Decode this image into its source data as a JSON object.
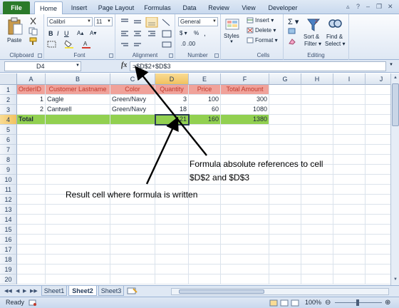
{
  "ribbon_tabs": {
    "file": "File",
    "items": [
      "Home",
      "Insert",
      "Page Layout",
      "Formulas",
      "Data",
      "Review",
      "View",
      "Developer"
    ]
  },
  "clipboard": {
    "paste": "Paste",
    "label": "Clipboard"
  },
  "font": {
    "name": "Calibri",
    "size": "11",
    "label": "Font"
  },
  "alignment": {
    "label": "Alignment"
  },
  "number": {
    "format": "General",
    "label": "Number"
  },
  "styles": {
    "styles": "Styles"
  },
  "cells": {
    "insert": "Insert",
    "delete": "Delete",
    "format": "Format",
    "label": "Cells"
  },
  "editing": {
    "sort_filter_1": "Sort &",
    "sort_filter_2": "Filter",
    "find_select_1": "Find &",
    "find_select_2": "Select",
    "label": "Editing"
  },
  "formula_bar": {
    "name_box": "D4",
    "fx": "fx",
    "formula": "=$D$2+$D$3"
  },
  "grid": {
    "columns": [
      "A",
      "B",
      "C",
      "D",
      "E",
      "F",
      "G",
      "H",
      "I",
      "J"
    ],
    "rows": [
      "1",
      "2",
      "3",
      "4",
      "5",
      "6",
      "7",
      "8",
      "9",
      "10",
      "11",
      "12",
      "13",
      "14",
      "15",
      "16",
      "17",
      "18",
      "19",
      "20"
    ],
    "header": [
      "OrderID",
      "Customer Lastname",
      "Color",
      "Quantity",
      "Price",
      "Total Amount"
    ],
    "row2": [
      "1",
      "Cagle",
      "Green/Navy",
      "3",
      "100",
      "300"
    ],
    "row3": [
      "2",
      "Cantwell",
      "Green/Navy",
      "18",
      "60",
      "1080"
    ],
    "row4": [
      "Total",
      "21",
      "160",
      "1380"
    ]
  },
  "sheets": [
    "Sheet1",
    "Sheet2",
    "Sheet3"
  ],
  "status": {
    "ready": "Ready",
    "zoom": "100%"
  },
  "annotations": {
    "formula_note_line1": "Formula absolute references to cell",
    "formula_note_line2": "$D$2  and $D$3",
    "result_note": "Result cell where formula is written"
  },
  "colors": {
    "file_tab": "#2a7a2a",
    "header_fill": "#f0a29a",
    "header_text": "#c0392b",
    "total_fill": "#92d050"
  }
}
